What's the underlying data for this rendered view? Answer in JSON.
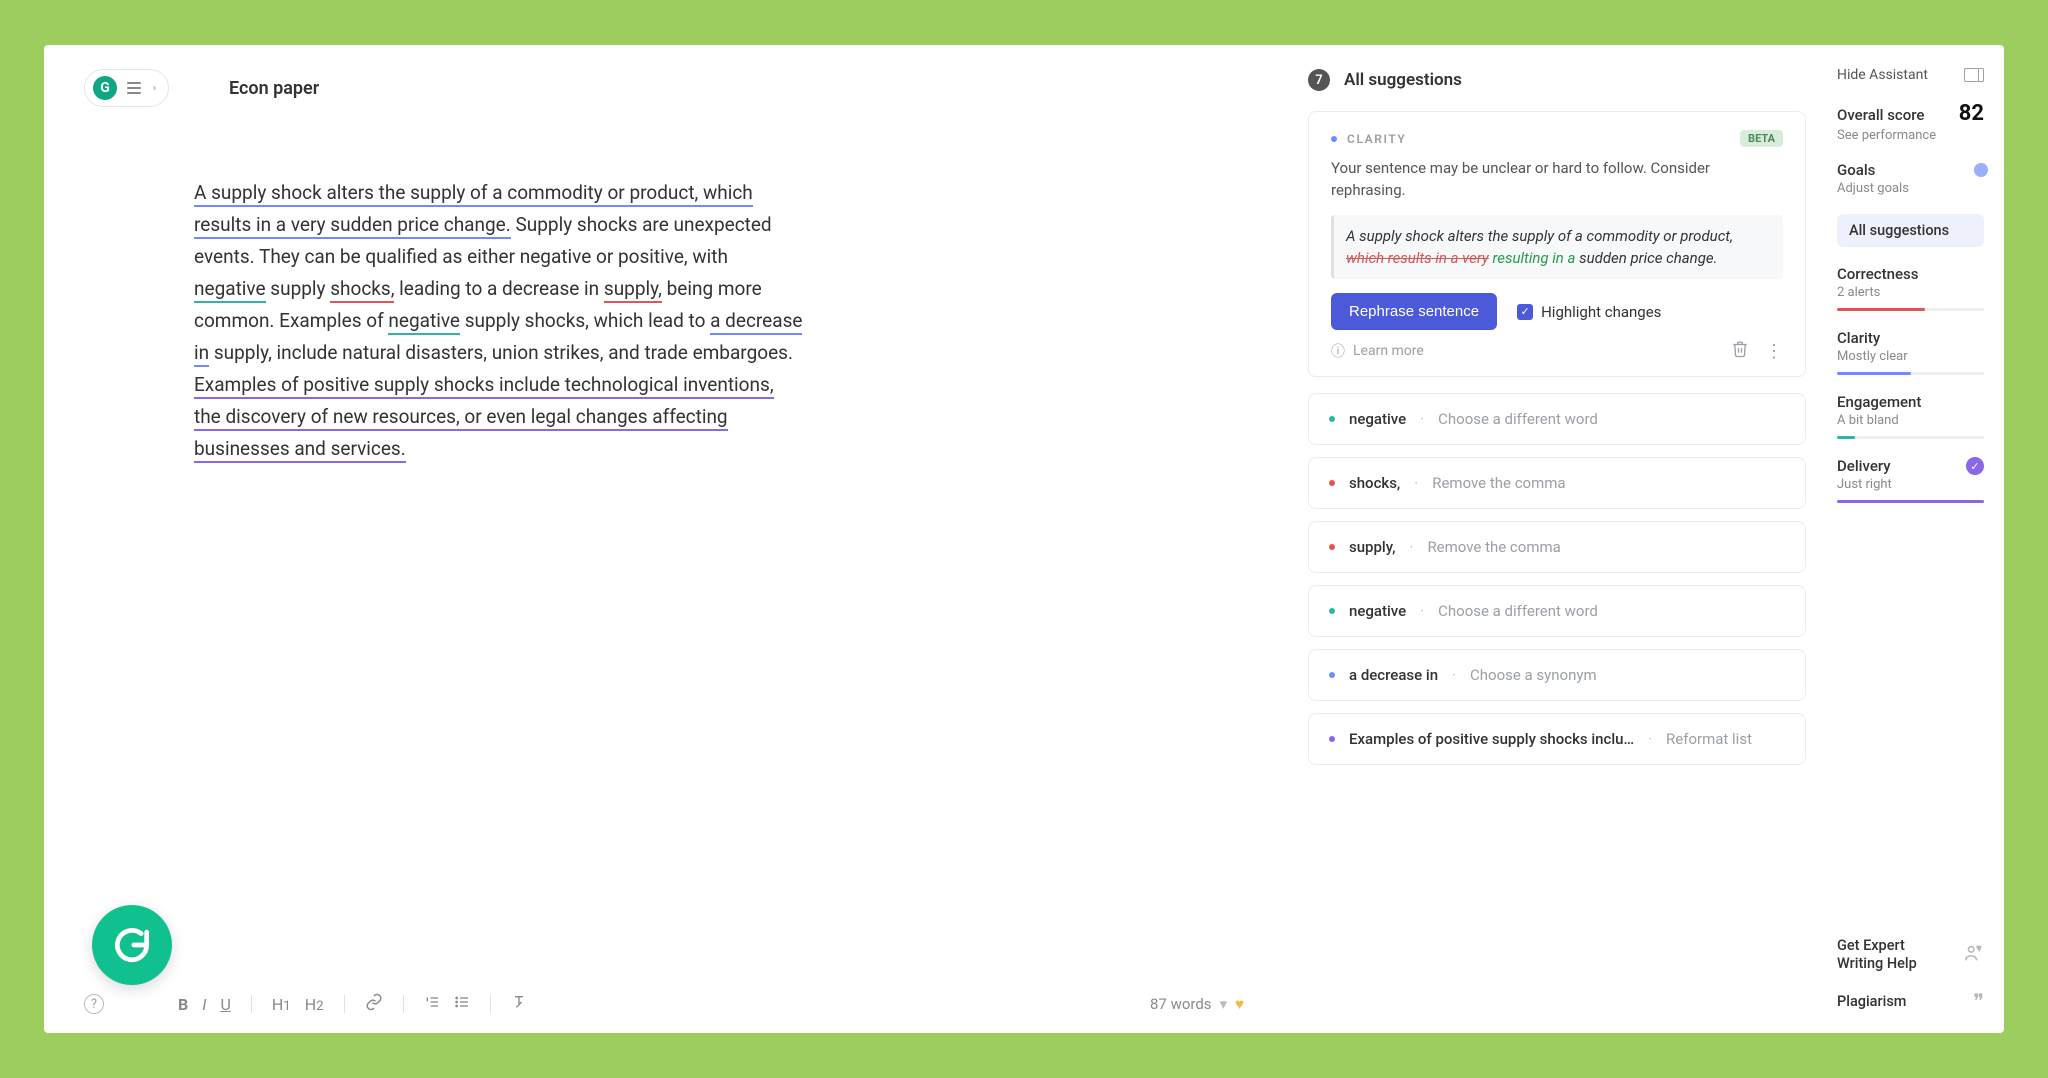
{
  "doc": {
    "title": "Econ paper",
    "text": {
      "s1a": "A supply shock alters the supply of a commodity or product, which results in a very sudden price change.",
      "s1b": " Supply shocks are unexpected events. They can be qualified as either negative or positive, with ",
      "w_negative1": "negative",
      "s1c": " supply ",
      "w_shocks": "shocks,",
      "s1d": " leading to a decrease in ",
      "w_supply": "supply,",
      "s1e": " being more common. Examples of ",
      "w_negative2": "negative",
      "s1f": " supply shocks, which lead to ",
      "w_decrease": "a decrease in",
      "s1g": " supply, include natural disasters, union strikes, and trade embargoes. ",
      "s2a": "Examples of positive supply shocks include technological inventions, the discovery of new resources, or even legal changes affecting businesses and services."
    },
    "wordcount": "87 words"
  },
  "suggestions": {
    "count": "7",
    "title": "All suggestions",
    "expanded": {
      "category": "CLARITY",
      "badge": "BETA",
      "desc": "Your sentence may be unclear or hard to follow. Consider rephrasing.",
      "pre": "A supply shock alters the supply of a commodity or product, ",
      "strike": "which results in a very",
      "insert": "resulting in a",
      "post": " sudden price change.",
      "action": "Rephrase sentence",
      "highlight": "Highlight changes",
      "learn": "Learn more"
    },
    "rows": [
      {
        "color": "teal",
        "term": "negative",
        "hint": "Choose a different word"
      },
      {
        "color": "red",
        "term": "shocks,",
        "hint": "Remove the comma"
      },
      {
        "color": "red",
        "term": "supply,",
        "hint": "Remove the comma"
      },
      {
        "color": "teal",
        "term": "negative",
        "hint": "Choose a different word"
      },
      {
        "color": "blue",
        "term": "a decrease in",
        "hint": "Choose a synonym"
      },
      {
        "color": "purple",
        "term": "Examples of positive supply shocks inclu…",
        "hint": "Reformat list"
      }
    ]
  },
  "assistant": {
    "hide": "Hide Assistant",
    "overall": {
      "label": "Overall score",
      "value": "82",
      "sub": "See performance"
    },
    "goals": {
      "label": "Goals",
      "sub": "Adjust goals"
    },
    "all": "All suggestions",
    "correctness": {
      "label": "Correctness",
      "sub": "2 alerts"
    },
    "clarity": {
      "label": "Clarity",
      "sub": "Mostly clear"
    },
    "engagement": {
      "label": "Engagement",
      "sub": "A bit bland"
    },
    "delivery": {
      "label": "Delivery",
      "sub": "Just right"
    },
    "expert": "Get Expert Writing Help",
    "plagiarism": "Plagiarism"
  }
}
